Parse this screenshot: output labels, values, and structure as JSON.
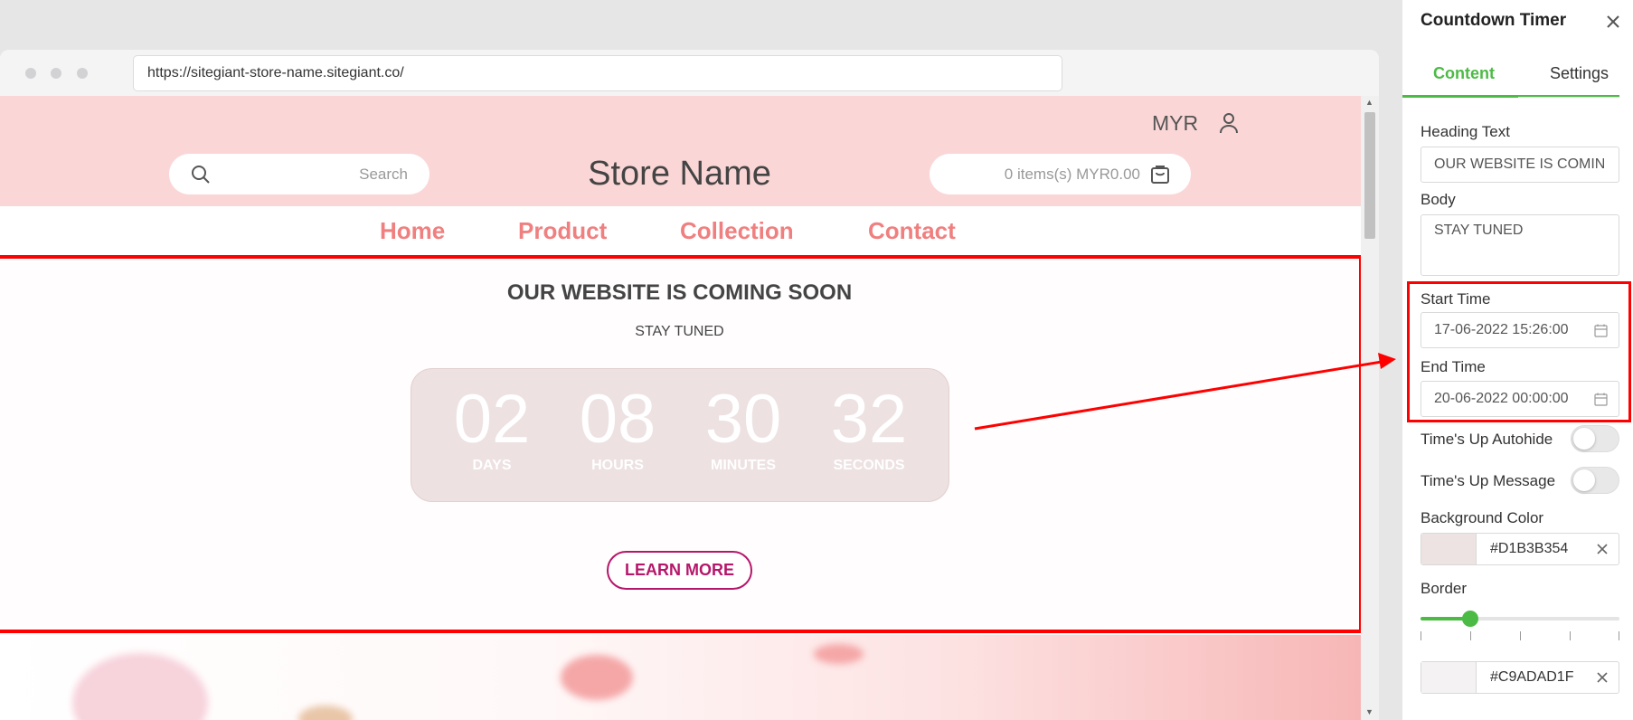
{
  "browser": {
    "url": "https://sitegiant-store-name.sitegiant.co/"
  },
  "store": {
    "currency": "MYR",
    "search_placeholder": "Search",
    "name": "Store Name",
    "cart_text": "0 items(s) MYR0.00",
    "nav": [
      "Home",
      "Product",
      "Collection",
      "Contact"
    ]
  },
  "countdown": {
    "heading": "OUR WEBSITE IS COMING SOON",
    "body": "STAY TUNED",
    "units": [
      {
        "value": "02",
        "label": "DAYS"
      },
      {
        "value": "08",
        "label": "HOURS"
      },
      {
        "value": "30",
        "label": "MINUTES"
      },
      {
        "value": "32",
        "label": "SECONDS"
      }
    ],
    "button": "LEARN MORE"
  },
  "panel": {
    "title": "Countdown Timer",
    "tabs": [
      "Content",
      "Settings"
    ],
    "active_tab": "Content",
    "heading_label": "Heading Text",
    "heading_value": "OUR WEBSITE IS COMIN",
    "body_label": "Body",
    "body_value": "STAY TUNED",
    "start_label": "Start Time",
    "start_value": "17-06-2022 15:26:00",
    "end_label": "End Time",
    "end_value": "20-06-2022 00:00:00",
    "autohide_label": "Time's Up Autohide",
    "autohide_on": false,
    "message_label": "Time's Up Message",
    "message_on": false,
    "bg_color_label": "Background Color",
    "bg_color_value": "#D1B3B354",
    "border_label": "Border",
    "border_level": 0.25,
    "border_color_value": "#C9ADAD1F"
  },
  "colors": {
    "accent": "#4cbb45",
    "nav_text": "#f08080",
    "header_bg": "#fbd6d6",
    "annotation": "#ff0000",
    "button_border": "#b5176a"
  }
}
